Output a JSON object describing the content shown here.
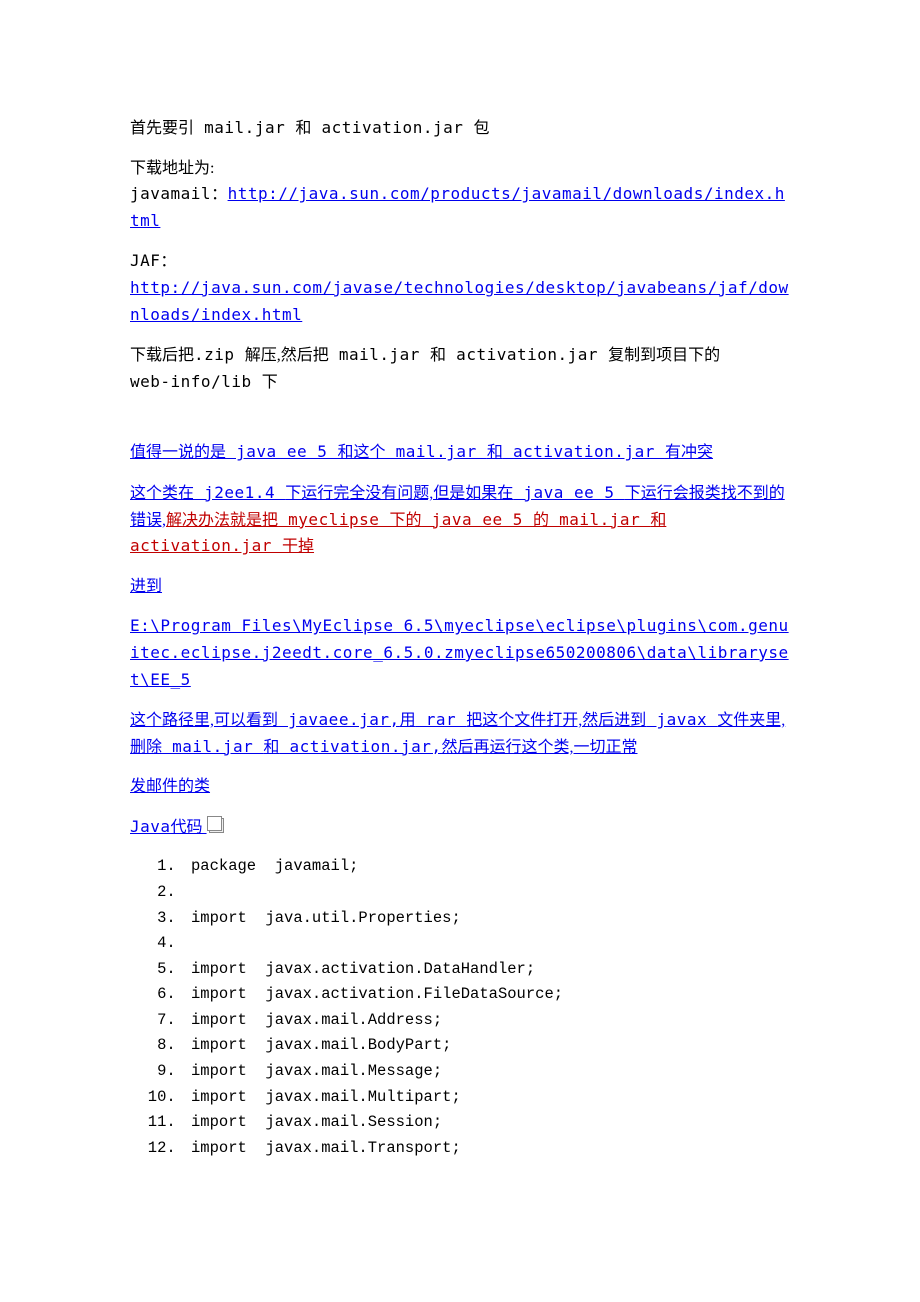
{
  "p1_a": "首先要引",
  "p1_b": " mail.jar ",
  "p1_c": "和",
  "p1_d": " activation.jar ",
  "p1_e": "包",
  "p2_a": "下载地址为:",
  "p2_b": "javamail：",
  "link1": "http://java.sun.com/products/javamail/downloads/index.html",
  "p3_a": "JAF：",
  "link2": "http://java.sun.com/javase/technologies/desktop/javabeans/jaf/downloads/index.html",
  "p4_a": "下载后把",
  "p4_b": ".zip ",
  "p4_c": "解压,然后把",
  "p4_d": " mail.jar ",
  "p4_e": "和",
  "p4_f": " activation.jar ",
  "p4_g": "复制到项目下的",
  "p4_h": "web-info/lib ",
  "p4_i": "下",
  "s1_a": "值得一说的是",
  "s1_b": " java ee 5 ",
  "s1_c": "和这个",
  "s1_d": " mail.jar ",
  "s1_e": "和",
  "s1_f": " activation.jar ",
  "s1_g": "有冲突 ",
  "s2_a": "这个类在",
  "s2_b": " j2ee1.4 ",
  "s2_c": "下运行完全没有问题,但是如果在",
  "s2_d": " java ee 5 ",
  "s2_e": "下运行会报类找不到的错误,",
  "s2_f": "解决办法就是把",
  "s2_g": " myeclipse ",
  "s2_h": "下的",
  "s2_i": " java ee 5 ",
  "s2_j": "的",
  "s2_k": " mail.jar ",
  "s2_l": "和",
  "s2_m": " activation.jar ",
  "s2_n": "干掉",
  "s3": "进到",
  "s4": "E:\\Program Files\\MyEclipse 6.5\\myeclipse\\eclipse\\plugins\\com.genuitec.eclipse.j2eedt.core_6.5.0.zmyeclipse650200806\\data\\libraryset\\EE_5       ",
  "s5_a": "这个路径里,可以看到",
  "s5_b": " javaee.jar,",
  "s5_c": "用",
  "s5_d": " rar ",
  "s5_e": "把这个文件打开,然后进到",
  "s5_f": " javax ",
  "s5_g": "文件夹里,删除",
  "s5_h": " mail.jar ",
  "s5_i": "和",
  "s5_j": " activation.jar,",
  "s5_k": "然后再运行这个类,一切正常",
  "s6": "发邮件的类",
  "s7_a": "Java",
  "s7_b": "代码 ",
  "code": [
    "package  javamail;",
    "",
    "import  java.util.Properties;",
    "",
    "import  javax.activation.DataHandler;",
    "import  javax.activation.FileDataSource;",
    "import  javax.mail.Address;",
    "import  javax.mail.BodyPart;",
    "import  javax.mail.Message;",
    "import  javax.mail.Multipart;",
    "import  javax.mail.Session;",
    "import  javax.mail.Transport;"
  ]
}
